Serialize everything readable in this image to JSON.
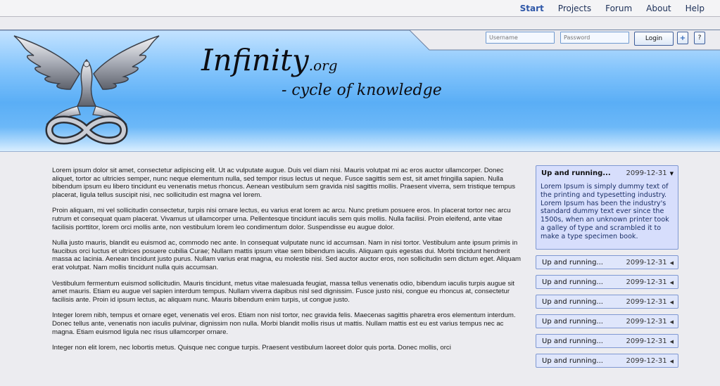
{
  "nav": {
    "items": [
      {
        "label": "Start",
        "active": true
      },
      {
        "label": "Projects",
        "active": false
      },
      {
        "label": "Forum",
        "active": false
      },
      {
        "label": "About",
        "active": false
      },
      {
        "label": "Help",
        "active": false
      }
    ]
  },
  "login": {
    "username_placeholder": "Username",
    "password_placeholder": "Password",
    "login_label": "Login",
    "plus_label": "+",
    "help_label": "?"
  },
  "brand": {
    "name": "Infinity",
    "tld": ".org",
    "tagline": "- cycle of knowledge"
  },
  "content": {
    "paragraphs": [
      " Lorem ipsum dolor sit amet, consectetur adipiscing elit. Ut ac vulputate augue. Duis vel diam nisi. Mauris volutpat mi ac eros auctor ullamcorper. Donec aliquet, tortor ac ultricies semper, nunc neque elementum nulla, sed tempor risus lectus ut neque. Fusce sagittis sem est, sit amet fringilla sapien. Nulla bibendum ipsum eu libero tincidunt eu venenatis metus rhoncus. Aenean vestibulum sem gravida nisl sagittis mollis. Praesent viverra, sem tristique tempus placerat, ligula tellus suscipit nisi, nec sollicitudin est magna vel lorem.",
      "Proin aliquam, mi vel sollicitudin consectetur, turpis nisi ornare lectus, eu varius erat lorem ac arcu. Nunc pretium posuere eros. In placerat tortor nec arcu rutrum et consequat quam placerat. Vivamus ut ullamcorper urna. Pellentesque tincidunt iaculis sem quis mollis. Nulla facilisi. Proin eleifend, ante vitae facilisis porttitor, lorem orci mollis ante, non vestibulum lorem leo condimentum dolor. Suspendisse eu augue dolor.",
      "Nulla justo mauris, blandit eu euismod ac, commodo nec ante. In consequat vulputate nunc id accumsan. Nam in nisi tortor. Vestibulum ante ipsum primis in faucibus orci luctus et ultrices posuere cubilia Curae; Nullam mattis ipsum vitae sem bibendum iaculis. Aliquam quis egestas dui. Morbi tincidunt hendrerit massa ac lacinia. Aenean tincidunt justo purus. Nullam varius erat magna, eu molestie nisi. Sed auctor auctor eros, non sollicitudin sem dictum eget. Aliquam erat volutpat. Nam mollis tincidunt nulla quis accumsan.",
      "Vestibulum fermentum euismod sollicitudin. Mauris tincidunt, metus vitae malesuada feugiat, massa tellus venenatis odio, bibendum iaculis turpis augue sit amet mauris. Etiam eu augue vel sapien interdum tempus. Nullam viverra dapibus nisl sed dignissim. Fusce justo nisi, congue eu rhoncus at, consectetur facilisis ante. Proin id ipsum lectus, ac aliquam nunc. Mauris bibendum enim turpis, ut congue justo.",
      "Integer lorem nibh, tempus et ornare eget, venenatis vel eros. Etiam non nisl tortor, nec gravida felis. Maecenas sagittis pharetra eros elementum interdum. Donec tellus ante, venenatis non iaculis pulvinar, dignissim non nulla. Morbi blandit mollis risus ut mattis. Nullam mattis est eu est varius tempus nec ac magna. Etiam euismod ligula nec risus ullamcorper ornare.",
      "Integer non elit lorem, nec lobortis metus. Quisque nec congue turpis. Praesent vestibulum laoreet dolor quis porta. Donec mollis, orci"
    ]
  },
  "news": {
    "open": {
      "title": "Up and running...",
      "date": "2099-12-31",
      "body": "Lorem Ipsum is simply dummy text of the printing and typesetting industry. Lorem Ipsum has been the industry's standard dummy text ever since the 1500s, when an unknown printer took a galley of type and scrambled it to make a type specimen book."
    },
    "items": [
      {
        "title": "Up and running...",
        "date": "2099-12-31"
      },
      {
        "title": "Up and running...",
        "date": "2099-12-31"
      },
      {
        "title": "Up and running...",
        "date": "2099-12-31"
      },
      {
        "title": "Up and running...",
        "date": "2099-12-31"
      },
      {
        "title": "Up and running...",
        "date": "2099-12-31"
      },
      {
        "title": "Up and running...",
        "date": "2099-12-31"
      }
    ]
  }
}
